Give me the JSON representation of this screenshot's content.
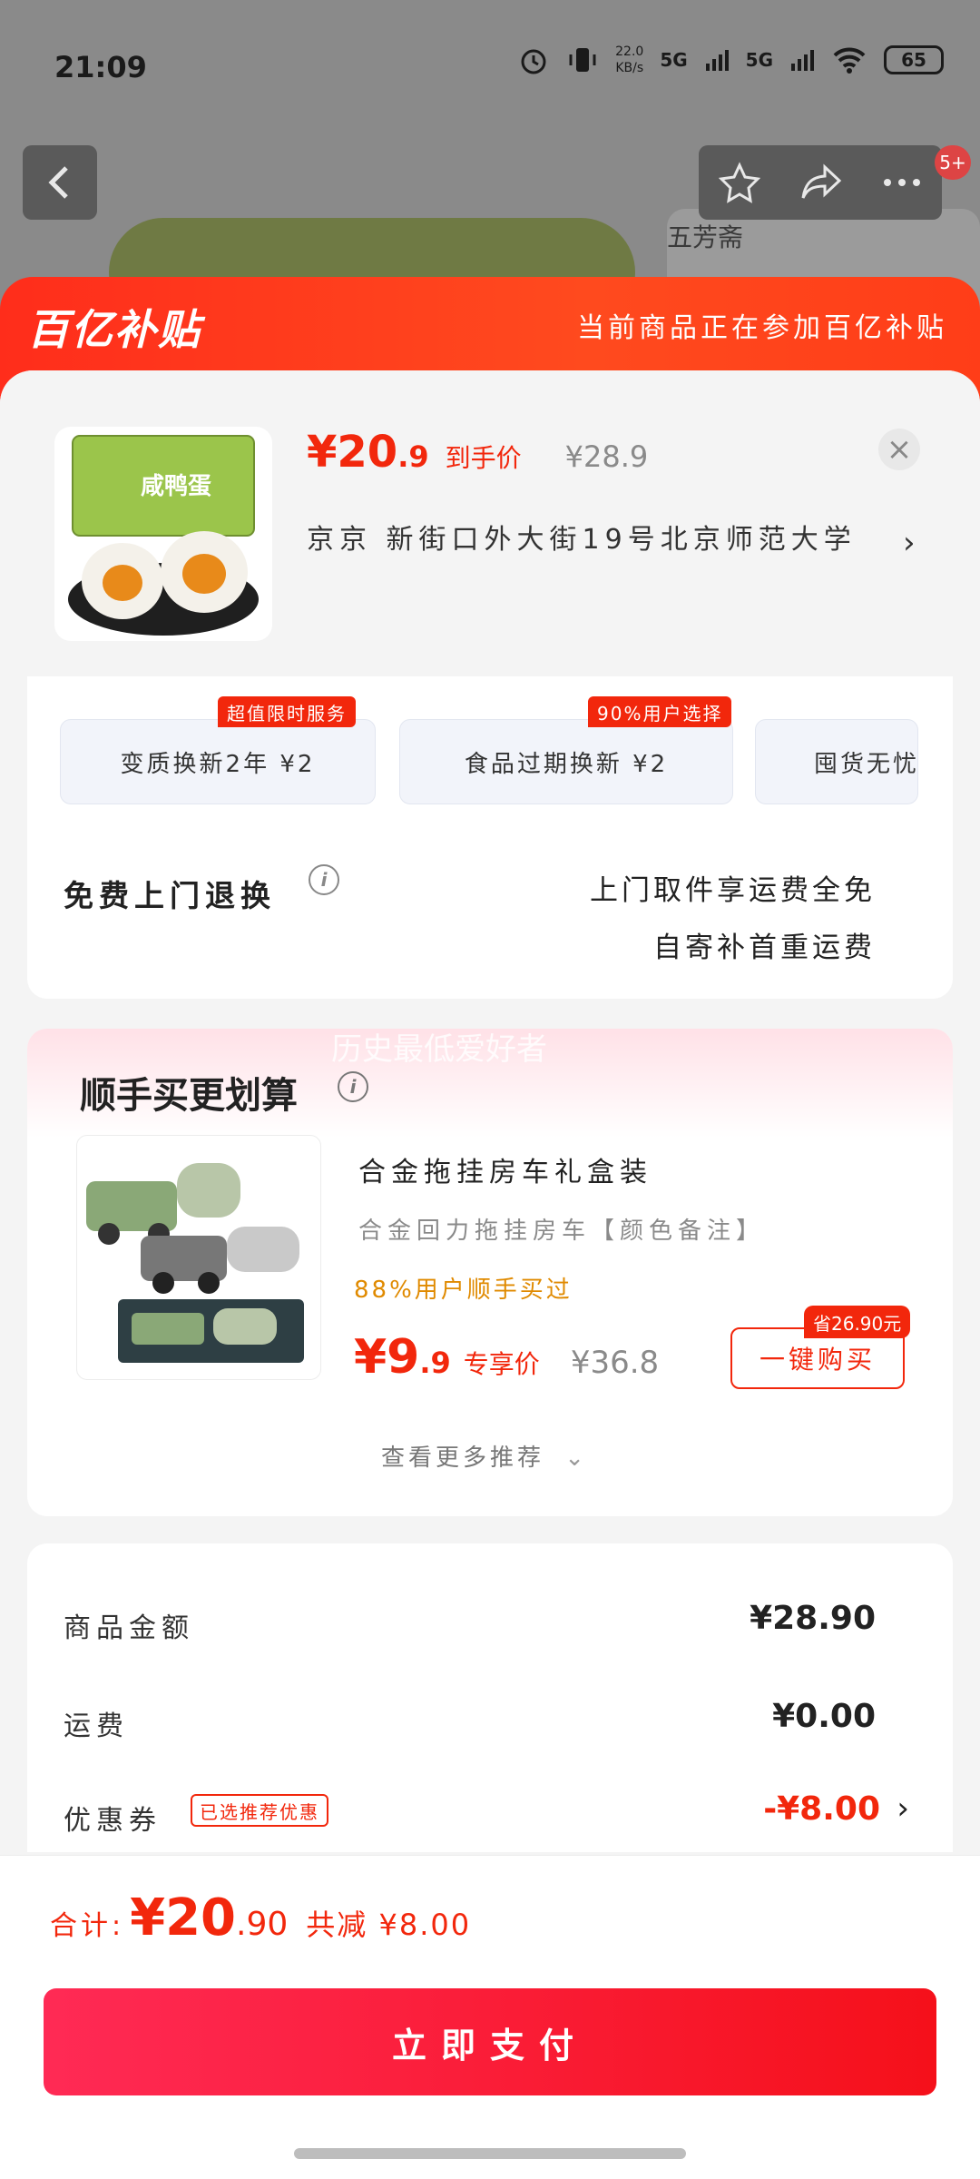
{
  "status_bar": {
    "time": "21:09",
    "net_speed": "22.0",
    "net_speed_unit": "KB/s",
    "signal1": "5G",
    "signal2": "5G",
    "battery": "65"
  },
  "background": {
    "brand": "五芳斋",
    "badge_count": "5+"
  },
  "header": {
    "logo_text": "百亿补贴",
    "slogan": "当前商品正在参加百亿补贴"
  },
  "product": {
    "price_int": "¥20",
    "price_dec": ".9",
    "price_label": "到手价",
    "original_price": "¥28.9",
    "address": "京京 新街口外大街19号北京师范大学",
    "thumb_label": "咸鸭蛋"
  },
  "services": {
    "chips": [
      {
        "label": "变质换新2年  ¥2",
        "badge": "超值限时服务"
      },
      {
        "label": "食品过期换新  ¥2",
        "badge": "90%用户选择"
      },
      {
        "label": "囤货无忧"
      }
    ],
    "free_return_title": "免费上门退换",
    "free_lines": [
      "上门取件享运费全免",
      "自寄补首重运费"
    ]
  },
  "upsell": {
    "watermark": "历史最低爱好者",
    "title": "顺手买更划算",
    "name": "合金拖挂房车礼盒装",
    "spec": "合金回力拖挂房车【颜色备注】",
    "rate": "88%用户顺手买过",
    "price_int": "¥9",
    "price_dec": ".9",
    "price_label": "专享价",
    "original_price": "¥36.8",
    "save_badge": "省26.90元",
    "buy_label": "一键购买",
    "more_label": "查看更多推荐"
  },
  "summary": {
    "rows": [
      {
        "label": "商品金额",
        "value": "¥28.90"
      },
      {
        "label": "运费",
        "value": "¥0.00"
      },
      {
        "label": "优惠券",
        "value": "-¥8.00"
      }
    ],
    "coupon_tag": "已选推荐优惠"
  },
  "footer": {
    "total_label": "合计:",
    "total_int": "¥20",
    "total_dec": ".90",
    "reduce_label": "共减",
    "reduce_value": "¥8.00",
    "pay_label": "立即支付"
  },
  "colors": {
    "accent": "#f2270c",
    "header_gradient": "#ff2d1b",
    "rate_orange": "#e08a00"
  }
}
